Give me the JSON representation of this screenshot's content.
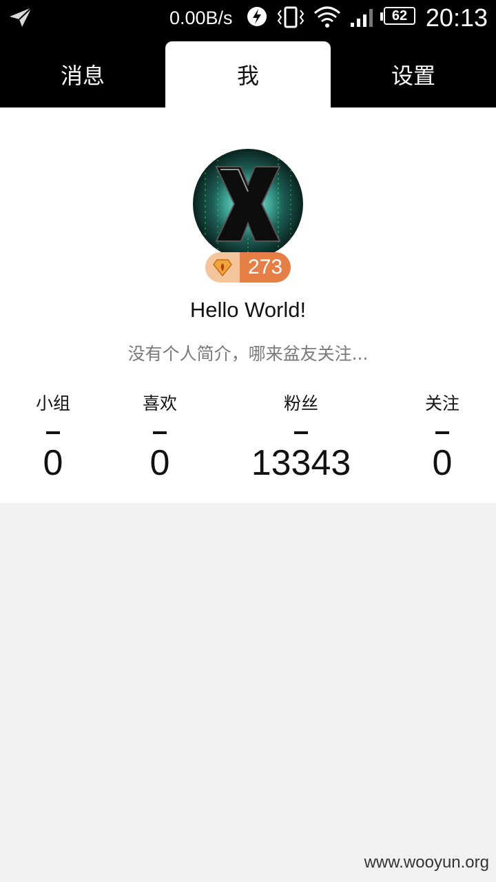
{
  "status_bar": {
    "net_speed": "0.00B/s",
    "battery": "62",
    "time": "20:13",
    "icons": [
      "send-icon",
      "flash-icon",
      "vibrate-icon",
      "wifi-icon",
      "signal-icon",
      "battery-icon"
    ]
  },
  "tabs": [
    {
      "label": "消息",
      "active": false
    },
    {
      "label": "我",
      "active": true
    },
    {
      "label": "设置",
      "active": false
    }
  ],
  "profile": {
    "level": "273",
    "username": "Hello World!",
    "bio": "没有个人简介，哪来盆友关注...",
    "stats": [
      {
        "label": "小组",
        "value": "0"
      },
      {
        "label": "喜欢",
        "value": "0"
      },
      {
        "label": "粉丝",
        "value": "13343"
      },
      {
        "label": "关注",
        "value": "0"
      }
    ]
  },
  "watermark": "www.wooyun.org",
  "colors": {
    "badge_left": "#f4c49a",
    "badge_right": "#e57f45",
    "background": "#f2f2f2"
  }
}
